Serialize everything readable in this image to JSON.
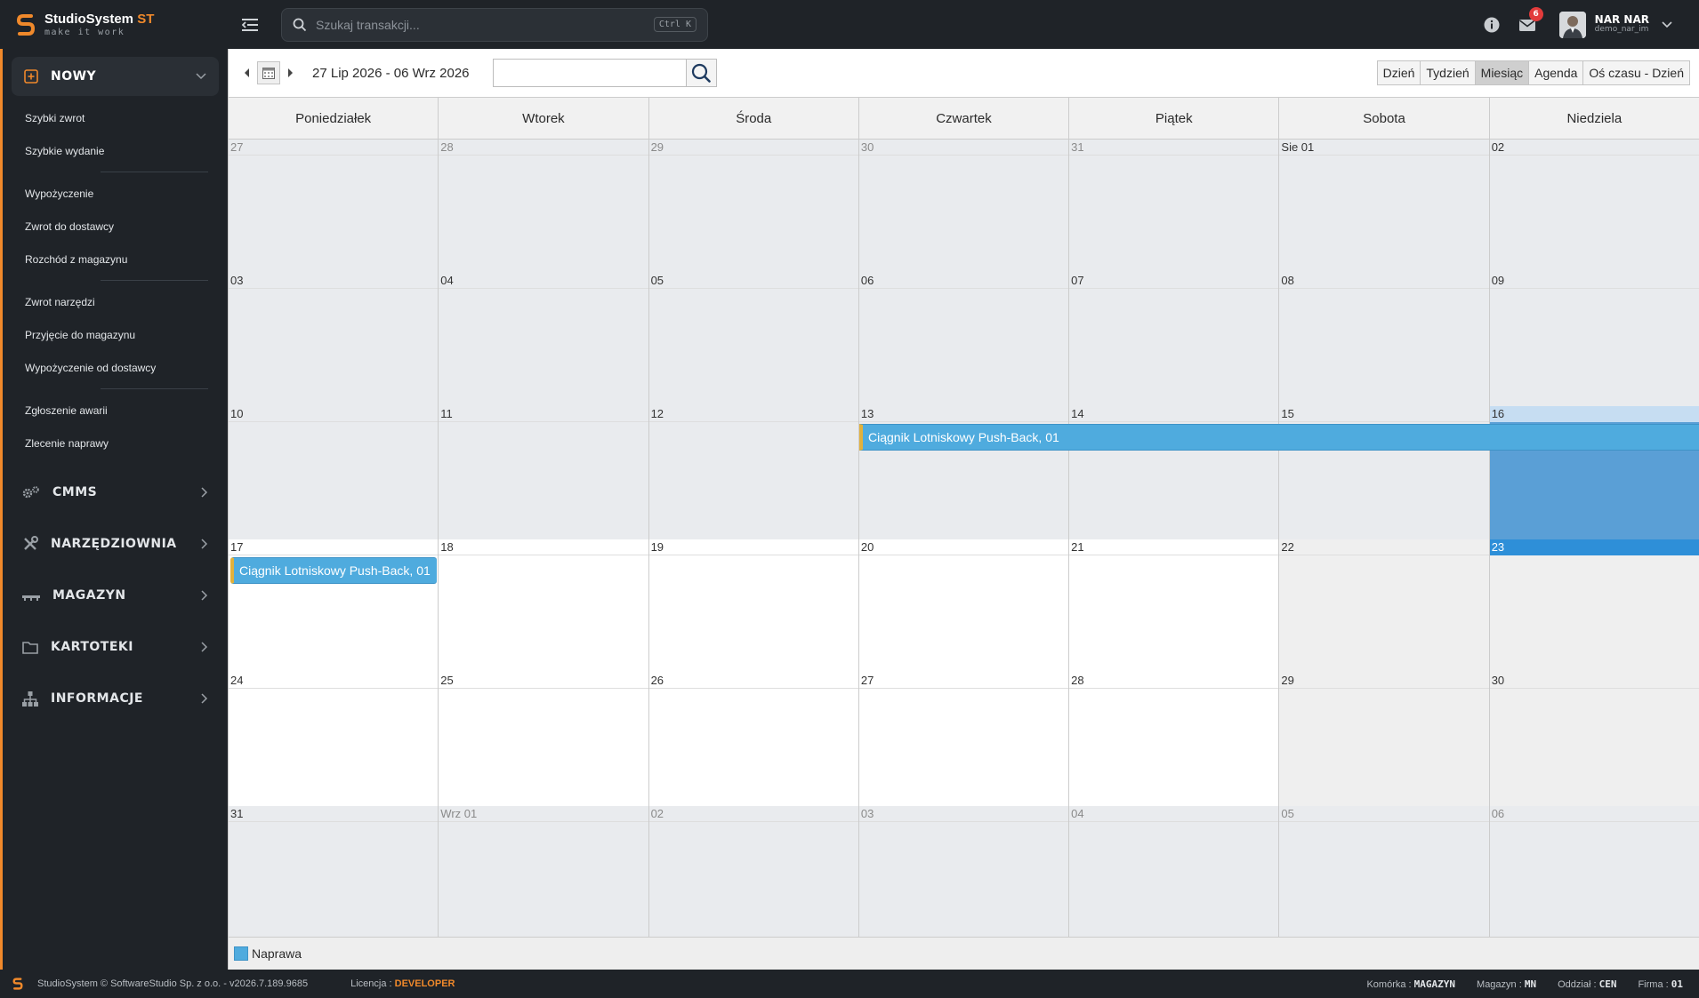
{
  "app": {
    "brand_name": "StudioSystem",
    "brand_suffix": "ST",
    "brand_tagline": "make it work",
    "brand_color": "#f0892b"
  },
  "topbar": {
    "search_placeholder": "Szukaj transakcji...",
    "search_shortcut": "Ctrl K",
    "messages_count": "6",
    "user_name": "NAR NAR",
    "user_login": "demo_nar_im"
  },
  "sidebar": {
    "active_section": {
      "label": "NOWY",
      "icon": "plus-square-icon"
    },
    "sub_items": [
      {
        "label": "Szybki zwrot"
      },
      {
        "label": "Szybkie wydanie"
      },
      {
        "label": "Wypożyczenie"
      },
      {
        "label": "Zwrot do dostawcy"
      },
      {
        "label": "Rozchód z magazynu"
      },
      {
        "label": "Zwrot narzędzi"
      },
      {
        "label": "Przyjęcie do magazynu"
      },
      {
        "label": "Wypożyczenie od dostawcy"
      },
      {
        "label": "Zgłoszenie awarii"
      },
      {
        "label": "Zlecenie naprawy"
      }
    ],
    "sections": [
      {
        "label": "CMMS",
        "icon": "gears-icon"
      },
      {
        "label": "NARZĘDZIOWNIA",
        "icon": "tools-icon"
      },
      {
        "label": "MAGAZYN",
        "icon": "warehouse-icon"
      },
      {
        "label": "KARTOTEKI",
        "icon": "folder-icon"
      },
      {
        "label": "INFORMACJE",
        "icon": "sitemap-icon"
      }
    ]
  },
  "calendar": {
    "date_range": "27 Lip 2026 - 06 Wrz 2026",
    "search_value": "",
    "views": [
      "Dzień",
      "Tydzień",
      "Miesiąc",
      "Agenda",
      "Oś czasu - Dzień"
    ],
    "active_view": "Miesiąc",
    "weekdays": [
      "Poniedziałek",
      "Wtorek",
      "Środa",
      "Czwartek",
      "Piątek",
      "Sobota",
      "Niedziela"
    ],
    "weeks": [
      [
        "27",
        "28",
        "29",
        "30",
        "31",
        "Sie 01",
        "02"
      ],
      [
        "03",
        "04",
        "05",
        "06",
        "07",
        "08",
        "09"
      ],
      [
        "10",
        "11",
        "12",
        "13",
        "14",
        "15",
        "16"
      ],
      [
        "17",
        "18",
        "19",
        "20",
        "21",
        "22",
        "23"
      ],
      [
        "24",
        "25",
        "26",
        "27",
        "28",
        "29",
        "30"
      ],
      [
        "31",
        "Wrz 01",
        "02",
        "03",
        "04",
        "05",
        "06"
      ]
    ],
    "events": [
      {
        "title": "Ciągnik Lotniskowy Push-Back, 01",
        "category": "Naprawa",
        "start": "13",
        "end": "16"
      },
      {
        "title": "Ciągnik Lotniskowy Push-Back, 01",
        "category": "Naprawa",
        "start": "17",
        "end": "17"
      }
    ],
    "legend": [
      {
        "label": "Naprawa",
        "color": "#4fabde"
      }
    ]
  },
  "footer": {
    "copyright": "StudioSystem © SoftwareStudio Sp. z o.o. - v2026.7.189.9685",
    "license_label": "Licencja :",
    "license_value": "DEVELOPER",
    "komorka_label": "Komórka :",
    "komorka_value": "MAGAZYN",
    "magazyn_label": "Magazyn :",
    "magazyn_value": "MN",
    "oddzial_label": "Oddział :",
    "oddzial_value": "CEN",
    "firma_label": "Firma :",
    "firma_value": "01"
  }
}
